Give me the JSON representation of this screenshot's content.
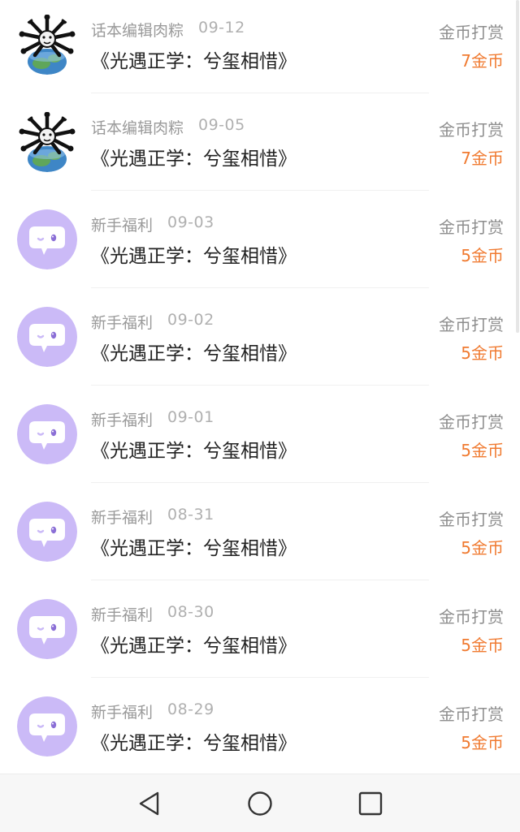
{
  "records": [
    {
      "sender": "话本编辑肉粽",
      "date": "09-12",
      "book": "《光遇正学：兮玺相惜》",
      "type": "金币打赏",
      "amount": "7金币",
      "avatar": "editor-avatar"
    },
    {
      "sender": "话本编辑肉粽",
      "date": "09-05",
      "book": "《光遇正学：兮玺相惜》",
      "type": "金币打赏",
      "amount": "7金币",
      "avatar": "editor-avatar"
    },
    {
      "sender": "新手福利",
      "date": "09-03",
      "book": "《光遇正学：兮玺相惜》",
      "type": "金币打赏",
      "amount": "5金币",
      "avatar": "chat-bubble-avatar"
    },
    {
      "sender": "新手福利",
      "date": "09-02",
      "book": "《光遇正学：兮玺相惜》",
      "type": "金币打赏",
      "amount": "5金币",
      "avatar": "chat-bubble-avatar"
    },
    {
      "sender": "新手福利",
      "date": "09-01",
      "book": "《光遇正学：兮玺相惜》",
      "type": "金币打赏",
      "amount": "5金币",
      "avatar": "chat-bubble-avatar"
    },
    {
      "sender": "新手福利",
      "date": "08-31",
      "book": "《光遇正学：兮玺相惜》",
      "type": "金币打赏",
      "amount": "5金币",
      "avatar": "chat-bubble-avatar"
    },
    {
      "sender": "新手福利",
      "date": "08-30",
      "book": "《光遇正学：兮玺相惜》",
      "type": "金币打赏",
      "amount": "5金币",
      "avatar": "chat-bubble-avatar"
    },
    {
      "sender": "新手福利",
      "date": "08-29",
      "book": "《光遇正学：兮玺相惜》",
      "type": "金币打赏",
      "amount": "5金币",
      "avatar": "chat-bubble-avatar"
    }
  ],
  "colors": {
    "amount": "#f07a30",
    "bubble_avatar_bg": "#cbbaf7"
  },
  "navbar": {
    "back_icon": "triangle-back-icon",
    "home_icon": "circle-home-icon",
    "recents_icon": "square-recents-icon"
  }
}
